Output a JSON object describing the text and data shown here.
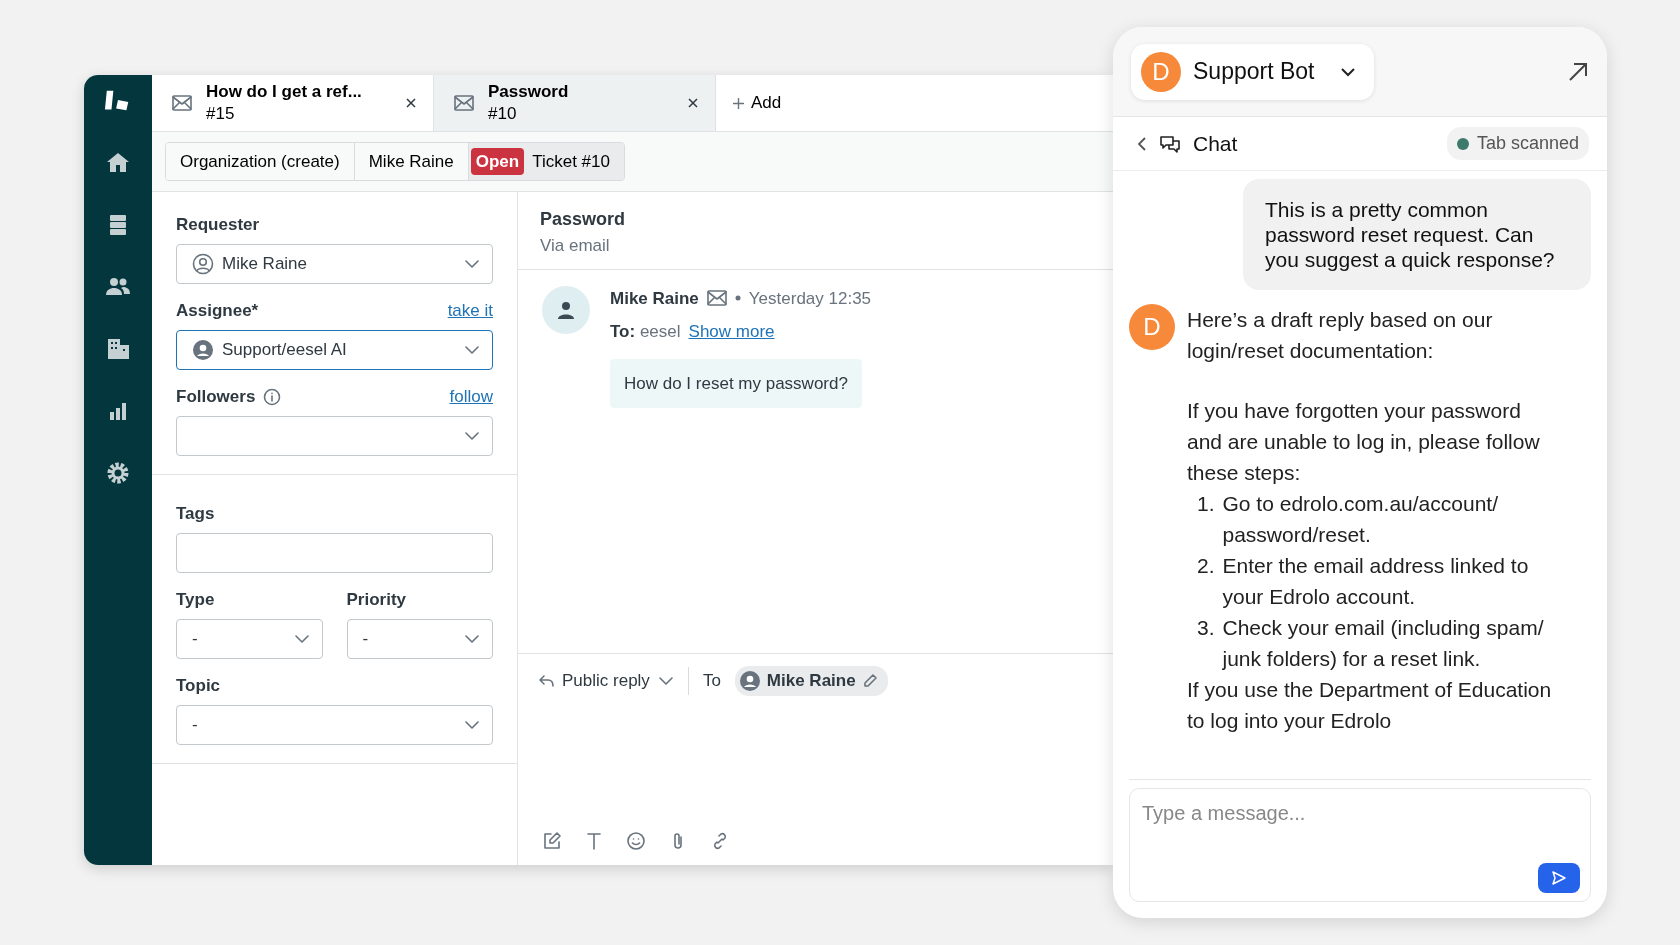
{
  "tabs": [
    {
      "title": "How do I get a ref...",
      "number": "#15",
      "selected": false
    },
    {
      "title": "Password",
      "number": "#10",
      "selected": true
    }
  ],
  "add_tab": "Add",
  "breadcrumbs": [
    {
      "label": "Organization (create)"
    },
    {
      "label": "Mike Raine"
    },
    {
      "badge": "Open",
      "label": "Ticket #10"
    }
  ],
  "ticket_sections": [
    {
      "rows": [
        [
          {
            "label": "Requester",
            "kind": "select",
            "value": "Mike Raine",
            "avatar": {
              "kind": "outline"
            },
            "focused": false
          }
        ],
        [
          {
            "label": "Assignee*",
            "kind": "select",
            "value": "Support/eesel AI",
            "avatar": {
              "kind": "filled"
            },
            "link": "take it",
            "focused": true
          }
        ],
        [
          {
            "label": "Followers",
            "kind": "select",
            "link": "follow",
            "focused": false,
            "info": true
          }
        ]
      ]
    },
    {
      "rows": [
        [
          {
            "label": "Tags",
            "kind": "text",
            "focused": false
          }
        ],
        [
          {
            "label": "Type",
            "kind": "select",
            "value": "-",
            "focused": false
          },
          {
            "label": "Priority",
            "kind": "select",
            "value": "-",
            "focused": false
          }
        ],
        [
          {
            "label": "Topic",
            "kind": "select",
            "value": "-",
            "focused": false
          }
        ]
      ]
    }
  ],
  "conversation": {
    "subject": "Password",
    "channel": "Via email",
    "messages": [
      {
        "author": "Mike Raine",
        "time": "Yesterday 12:35",
        "to_label": "To:",
        "to": "eesel",
        "link": "Show more",
        "body": "How do I reset my password?"
      }
    ]
  },
  "reply": {
    "mode": "Public reply",
    "to_label": "To",
    "recipient": "Mike Raine"
  },
  "chat": {
    "bot_name": "Support Bot",
    "avatar_letter": "D",
    "section": "Chat",
    "status": "Tab scanned",
    "messages": [
      {
        "kind": "user",
        "text": "This is a pretty common password reset request. Can you suggest a quick response?"
      },
      {
        "kind": "bot",
        "avatar_letter": "D",
        "intro": "Here’s a draft reply based on our login/reset documentation:",
        "lead": "If you have forgotten your password and are unable to log in, please follow these steps:",
        "steps": [
          {
            "number": "1.",
            "text": "Go to edrolo.com.au/account/ password/reset."
          },
          {
            "number": "2.",
            "text": "Enter the email address linked to your Edrolo account."
          },
          {
            "number": "3.",
            "text": "Check your email (including spam/ junk folders) for a reset link."
          }
        ],
        "closing": "If you use the Department of Education to log into your Edrolo"
      }
    ],
    "input": {
      "placeholder": "Type a message..."
    }
  }
}
